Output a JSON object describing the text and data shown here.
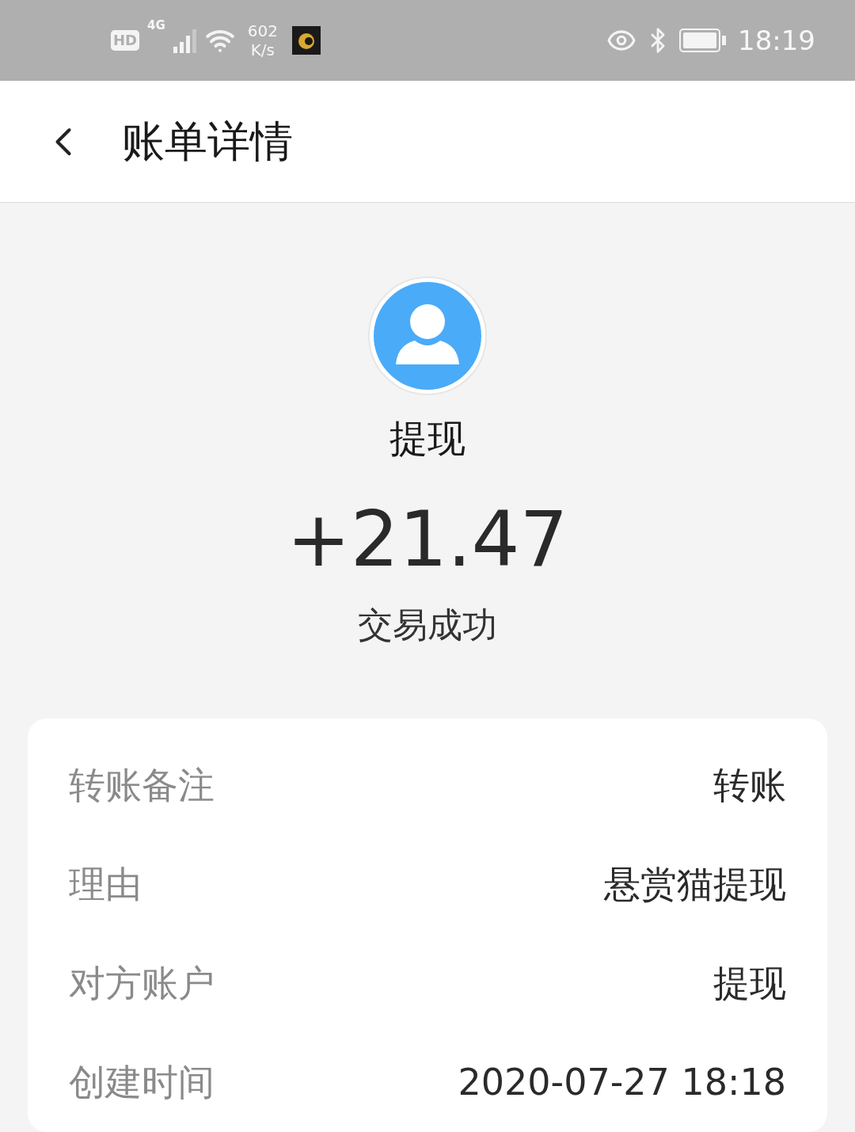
{
  "status_bar": {
    "hd": "HD",
    "network": "4G",
    "speed_value": "602",
    "speed_unit": "K/s",
    "time": "18:19"
  },
  "header": {
    "title": "账单详情"
  },
  "summary": {
    "title": "提现",
    "amount": "+21.47",
    "status": "交易成功"
  },
  "details": [
    {
      "label": "转账备注",
      "value": "转账"
    },
    {
      "label": "理由",
      "value": "悬赏猫提现"
    },
    {
      "label": "对方账户",
      "value": "提现"
    },
    {
      "label": "创建时间",
      "value": "2020-07-27 18:18"
    }
  ]
}
